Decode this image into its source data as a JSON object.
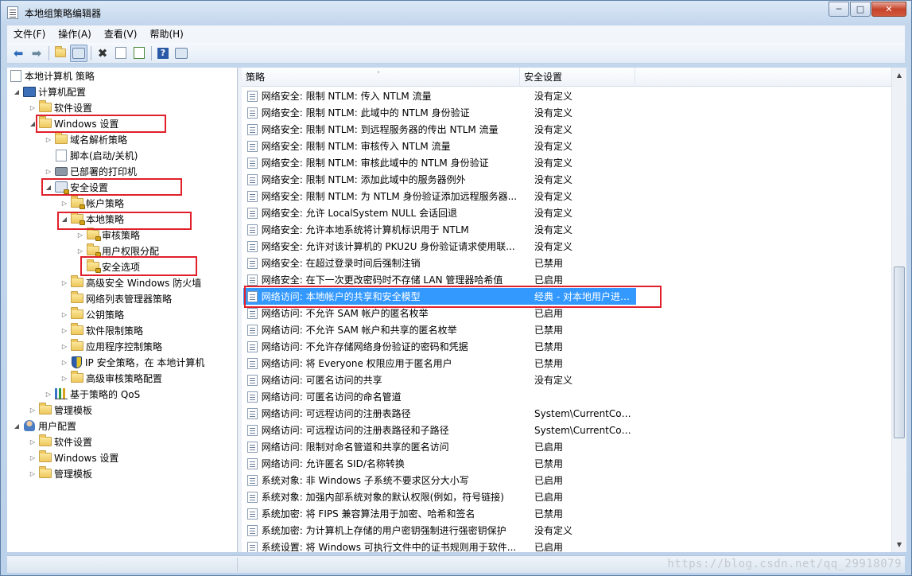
{
  "window": {
    "title": "本地组策略编辑器",
    "minimize_label": "─",
    "maximize_label": "□",
    "close_label": "✕"
  },
  "menu": [
    "文件(F)",
    "操作(A)",
    "查看(V)",
    "帮助(H)"
  ],
  "toolbar": {
    "icons": [
      "back-arrow",
      "forward-arrow",
      "up-folder",
      "show-hide-tree",
      "delete",
      "properties",
      "export-list",
      "help",
      "console-view"
    ],
    "back_glyph": "⬅",
    "forward_glyph": "➡",
    "delete_glyph": "✖",
    "help_glyph": "?"
  },
  "tree": {
    "root": "本地计算机 策略",
    "computer_config": "计算机配置",
    "software_settings": "软件设置",
    "windows_settings": "Windows 设置",
    "name_resolution_policy": "域名解析策略",
    "scripts": "脚本(启动/关机)",
    "deployed_printers": "已部署的打印机",
    "security_settings": "安全设置",
    "account_policies": "帐户策略",
    "local_policies": "本地策略",
    "audit_policy": "审核策略",
    "user_rights": "用户权限分配",
    "security_options": "安全选项",
    "advanced_firewall": "高级安全 Windows 防火墙",
    "network_list_manager": "网络列表管理器策略",
    "public_key_policies": "公钥策略",
    "software_restriction": "软件限制策略",
    "app_control": "应用程序控制策略",
    "ip_security": "IP 安全策略，在 本地计算机",
    "advanced_audit": "高级审核策略配置",
    "qos": "基于策略的 QoS",
    "admin_templates": "管理模板",
    "user_config": "用户配置",
    "user_software_settings": "软件设置",
    "user_windows_settings": "Windows 设置",
    "user_admin_templates": "管理模板"
  },
  "list": {
    "columns": {
      "policy": "策略",
      "setting": "安全设置",
      "sort_indicator": "˄"
    },
    "selected_index": 12,
    "rows": [
      {
        "policy": "网络安全: 限制 NTLM: 传入 NTLM 流量",
        "setting": "没有定义"
      },
      {
        "policy": "网络安全: 限制 NTLM: 此域中的 NTLM 身份验证",
        "setting": "没有定义"
      },
      {
        "policy": "网络安全: 限制 NTLM: 到远程服务器的传出 NTLM 流量",
        "setting": "没有定义"
      },
      {
        "policy": "网络安全: 限制 NTLM: 审核传入 NTLM 流量",
        "setting": "没有定义"
      },
      {
        "policy": "网络安全: 限制 NTLM: 审核此域中的 NTLM 身份验证",
        "setting": "没有定义"
      },
      {
        "policy": "网络安全: 限制 NTLM: 添加此域中的服务器例外",
        "setting": "没有定义"
      },
      {
        "policy": "网络安全: 限制 NTLM: 为 NTLM 身份验证添加远程服务器...",
        "setting": "没有定义"
      },
      {
        "policy": "网络安全: 允许 LocalSystem NULL 会话回退",
        "setting": "没有定义"
      },
      {
        "policy": "网络安全: 允许本地系统将计算机标识用于 NTLM",
        "setting": "没有定义"
      },
      {
        "policy": "网络安全: 允许对该计算机的 PKU2U 身份验证请求使用联...",
        "setting": "没有定义"
      },
      {
        "policy": "网络安全: 在超过登录时间后强制注销",
        "setting": "已禁用"
      },
      {
        "policy": "网络安全: 在下一次更改密码时不存储 LAN 管理器哈希值",
        "setting": "已启用"
      },
      {
        "policy": "网络访问: 本地帐户的共享和安全模型",
        "setting": "经典 - 对本地用户进行..."
      },
      {
        "policy": "网络访问: 不允许 SAM 帐户的匿名枚举",
        "setting": "已启用"
      },
      {
        "policy": "网络访问: 不允许 SAM 帐户和共享的匿名枚举",
        "setting": "已禁用"
      },
      {
        "policy": "网络访问: 不允许存储网络身份验证的密码和凭据",
        "setting": "已禁用"
      },
      {
        "policy": "网络访问: 将 Everyone 权限应用于匿名用户",
        "setting": "已禁用"
      },
      {
        "policy": "网络访问: 可匿名访问的共享",
        "setting": "没有定义"
      },
      {
        "policy": "网络访问: 可匿名访问的命名管道",
        "setting": ""
      },
      {
        "policy": "网络访问: 可远程访问的注册表路径",
        "setting": "System\\CurrentContro..."
      },
      {
        "policy": "网络访问: 可远程访问的注册表路径和子路径",
        "setting": "System\\CurrentContro..."
      },
      {
        "policy": "网络访问: 限制对命名管道和共享的匿名访问",
        "setting": "已启用"
      },
      {
        "policy": "网络访问: 允许匿名 SID/名称转换",
        "setting": "已禁用"
      },
      {
        "policy": "系统对象: 非 Windows 子系统不要求区分大小写",
        "setting": "已启用"
      },
      {
        "policy": "系统对象: 加强内部系统对象的默认权限(例如，符号链接)",
        "setting": "已启用"
      },
      {
        "policy": "系统加密: 将 FIPS 兼容算法用于加密、哈希和签名",
        "setting": "已禁用"
      },
      {
        "policy": "系统加密: 为计算机上存储的用户密钥强制进行强密钥保护",
        "setting": "没有定义"
      },
      {
        "policy": "系统设置: 将 Windows 可执行文件中的证书规则用于软件...",
        "setting": "已启用"
      }
    ]
  },
  "watermark": "https://blog.csdn.net/qq_29918079",
  "colors": {
    "selection": "#3399ff",
    "highlight_box": "#e0202a",
    "title_bg": "#c3d6ec"
  }
}
